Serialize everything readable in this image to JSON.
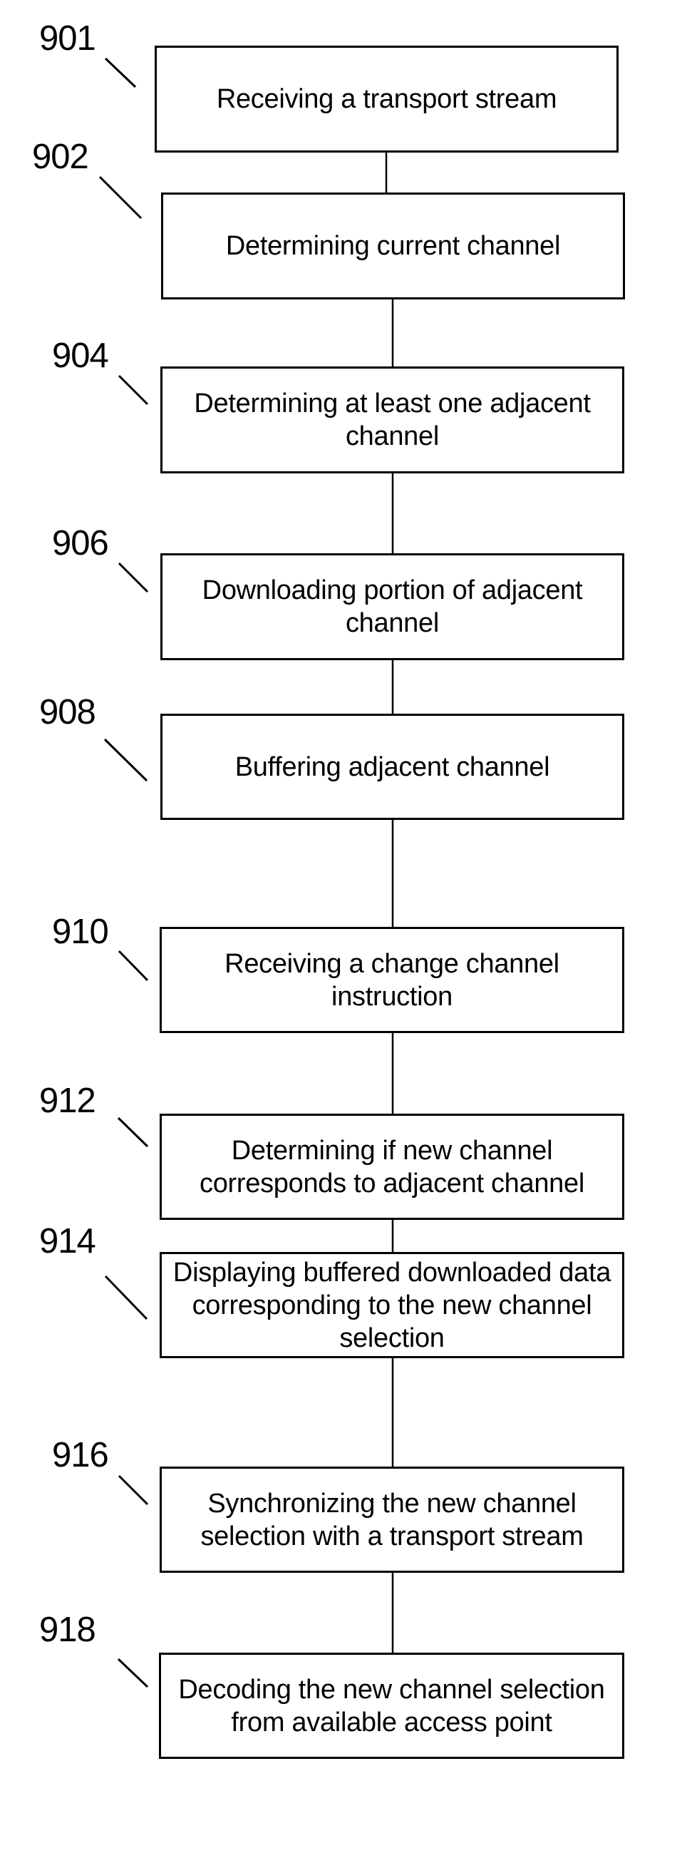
{
  "figure": {
    "type": "flowchart",
    "steps": [
      {
        "ref": "901",
        "text": "Receiving a transport stream"
      },
      {
        "ref": "902",
        "text": "Determining current channel"
      },
      {
        "ref": "904",
        "text": "Determining at least one adjacent channel"
      },
      {
        "ref": "906",
        "text": "Downloading portion of adjacent channel"
      },
      {
        "ref": "908",
        "text": "Buffering adjacent channel"
      },
      {
        "ref": "910",
        "text": "Receiving a change channel instruction"
      },
      {
        "ref": "912",
        "text": "Determining if new channel corresponds to adjacent channel"
      },
      {
        "ref": "914",
        "text": "Displaying buffered downloaded data corresponding to the new channel selection"
      },
      {
        "ref": "916",
        "text": "Synchronizing the new channel selection with a transport stream"
      },
      {
        "ref": "918",
        "text": "Decoding the new channel selection from available access point"
      }
    ],
    "connections": [
      [
        "901",
        "902"
      ],
      [
        "902",
        "904"
      ],
      [
        "904",
        "906"
      ],
      [
        "906",
        "908"
      ],
      [
        "908",
        "910"
      ],
      [
        "910",
        "912"
      ],
      [
        "912",
        "914"
      ],
      [
        "914",
        "916"
      ],
      [
        "916",
        "918"
      ]
    ],
    "colors": {
      "line": "#000000",
      "background": "#ffffff"
    }
  }
}
